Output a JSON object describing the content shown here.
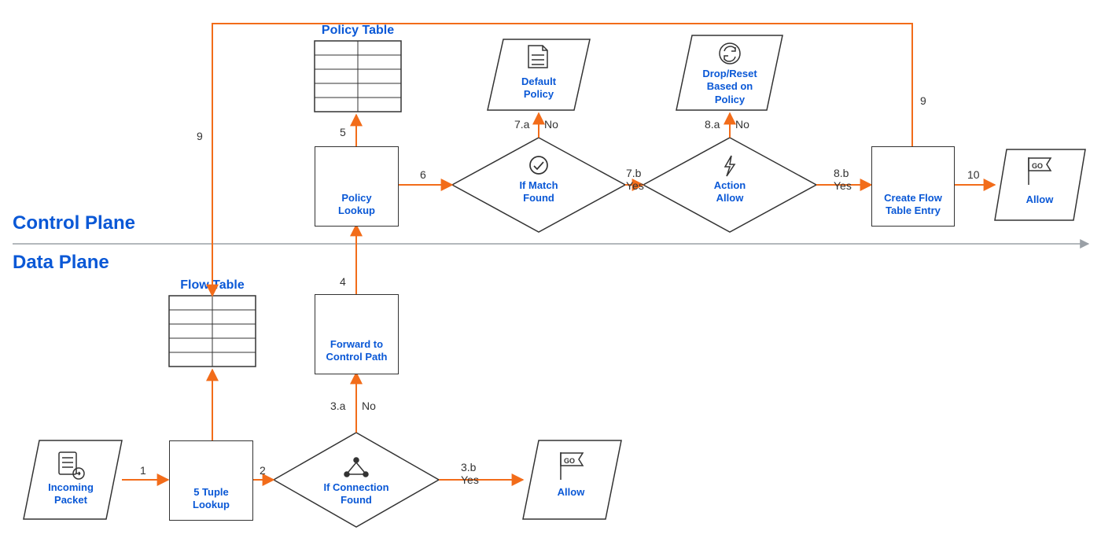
{
  "planes": {
    "control": "Control Plane",
    "data": "Data Plane"
  },
  "titles": {
    "policy_table": "Policy Table",
    "flow_table": "Flow Table"
  },
  "nodes": {
    "incoming_packet": "Incoming\nPacket",
    "tuple_lookup": "5 Tuple\nLookup",
    "if_connection": "If Connection\nFound",
    "allow_data": "Allow",
    "forward_cp": "Forward to\nControl Path",
    "policy_lookup": "Policy\nLookup",
    "if_match": "If Match\nFound",
    "default_policy": "Default\nPolicy",
    "action_allow": "Action\nAllow",
    "drop_reset": "Drop/Reset\nBased on\nPolicy",
    "create_flow": "Create Flow\nTable Entry",
    "allow_ctrl": "Allow"
  },
  "edges": {
    "e1": {
      "num": "1",
      "label": ""
    },
    "e2": {
      "num": "2",
      "label": ""
    },
    "e3a": {
      "num": "3.a",
      "label": "No"
    },
    "e3b": {
      "num": "3.b",
      "label": "Yes"
    },
    "e4": {
      "num": "4",
      "label": ""
    },
    "e5": {
      "num": "5",
      "label": ""
    },
    "e6": {
      "num": "6",
      "label": ""
    },
    "e7a": {
      "num": "7.a",
      "label": "No"
    },
    "e7b": {
      "num": "7.b",
      "label": "Yes"
    },
    "e8a": {
      "num": "8.a",
      "label": "No"
    },
    "e8b": {
      "num": "8.b",
      "label": "Yes"
    },
    "e9c": {
      "num": "9",
      "label": ""
    },
    "e9d": {
      "num": "9",
      "label": ""
    },
    "e10": {
      "num": "10",
      "label": ""
    }
  }
}
